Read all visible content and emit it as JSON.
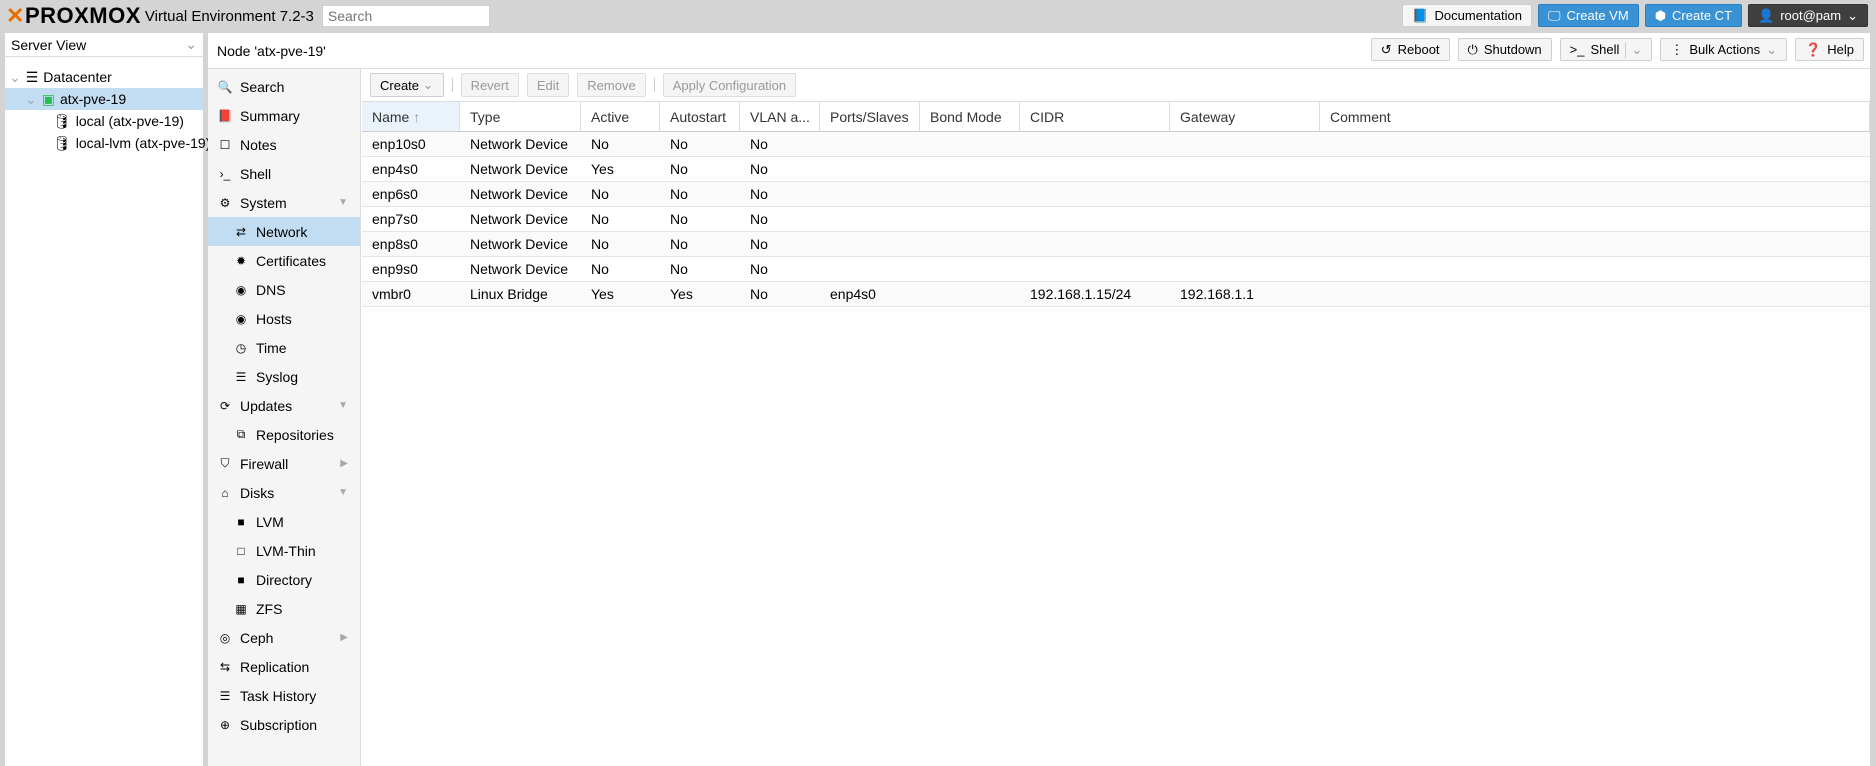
{
  "header": {
    "logo": "PROXMOX",
    "version": "Virtual Environment 7.2-3",
    "search_placeholder": "Search",
    "documentation": "Documentation",
    "create_vm": "Create VM",
    "create_ct": "Create CT",
    "user": "root@pam"
  },
  "tree": {
    "view": "Server View",
    "items": [
      "Datacenter",
      "atx-pve-19",
      "local (atx-pve-19)",
      "local-lvm (atx-pve-19)"
    ]
  },
  "node": {
    "title": "Node 'atx-pve-19'",
    "reboot": "Reboot",
    "shutdown": "Shutdown",
    "shell": "Shell",
    "bulk": "Bulk Actions",
    "help": "Help"
  },
  "nav": [
    "Search",
    "Summary",
    "Notes",
    "Shell",
    "System",
    "Network",
    "Certificates",
    "DNS",
    "Hosts",
    "Time",
    "Syslog",
    "Updates",
    "Repositories",
    "Firewall",
    "Disks",
    "LVM",
    "LVM-Thin",
    "Directory",
    "ZFS",
    "Ceph",
    "Replication",
    "Task History",
    "Subscription"
  ],
  "toolbar": {
    "create": "Create",
    "revert": "Revert",
    "edit": "Edit",
    "remove": "Remove",
    "apply": "Apply Configuration"
  },
  "columns": [
    "Name",
    "Type",
    "Active",
    "Autostart",
    "VLAN a...",
    "Ports/Slaves",
    "Bond Mode",
    "CIDR",
    "Gateway",
    "Comment"
  ],
  "rows": [
    [
      "enp10s0",
      "Network Device",
      "No",
      "No",
      "No",
      "",
      "",
      "",
      "",
      ""
    ],
    [
      "enp4s0",
      "Network Device",
      "Yes",
      "No",
      "No",
      "",
      "",
      "",
      "",
      ""
    ],
    [
      "enp6s0",
      "Network Device",
      "No",
      "No",
      "No",
      "",
      "",
      "",
      "",
      ""
    ],
    [
      "enp7s0",
      "Network Device",
      "No",
      "No",
      "No",
      "",
      "",
      "",
      "",
      ""
    ],
    [
      "enp8s0",
      "Network Device",
      "No",
      "No",
      "No",
      "",
      "",
      "",
      "",
      ""
    ],
    [
      "enp9s0",
      "Network Device",
      "No",
      "No",
      "No",
      "",
      "",
      "",
      "",
      ""
    ],
    [
      "vmbr0",
      "Linux Bridge",
      "Yes",
      "Yes",
      "No",
      "enp4s0",
      "",
      "192.168.1.15/24",
      "192.168.1.1",
      ""
    ]
  ]
}
